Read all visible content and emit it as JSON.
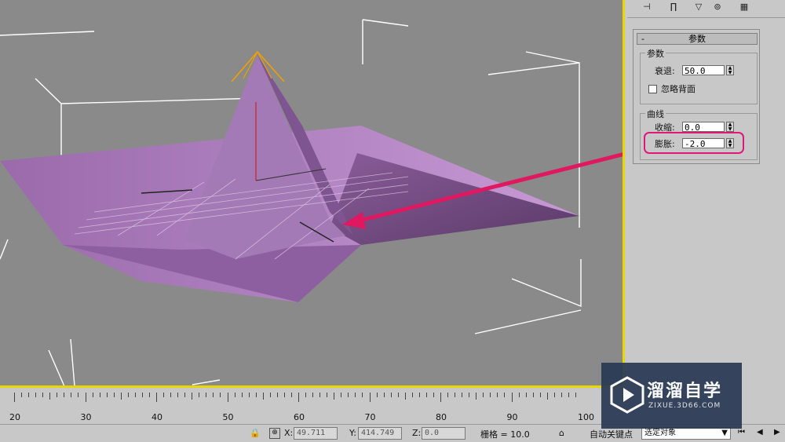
{
  "toolbar": {
    "buttons": [
      "pin-icon",
      "modifier-stack-icon",
      "funnel-icon",
      "delete-icon",
      "configure-icon"
    ]
  },
  "rollout": {
    "minus": "-",
    "title": "参数",
    "params_group": "参数",
    "falloff_label": "衰退:",
    "falloff_value": "50.0",
    "ignore_backface_label": "忽略背面",
    "curve_group": "曲线",
    "pinch_label": "收缩:",
    "pinch_value": "0.0",
    "bubble_label": "膨胀:",
    "bubble_value": "-2.0"
  },
  "ruler": {
    "ticks": [
      "20",
      "30",
      "40",
      "50",
      "60",
      "70",
      "80",
      "90",
      "100"
    ]
  },
  "status": {
    "x_label": "X:",
    "x_value": "49.711",
    "y_label": "Y:",
    "y_value": "414.749",
    "z_label": "Z:",
    "z_value": "0.0",
    "grid_text": "栅格 = 10.0",
    "auto_key": "自动关键点",
    "selection": "选定对象"
  },
  "watermark": {
    "title": "溜溜自学",
    "subtitle": "ZIXUE.3D66.COM"
  },
  "colors": {
    "viewport_bg": "#8a8a8a",
    "viewport_border": "#e8d800",
    "surface": "#a878b8",
    "arrow": "#e0185f",
    "highlight": "#e0187a"
  }
}
